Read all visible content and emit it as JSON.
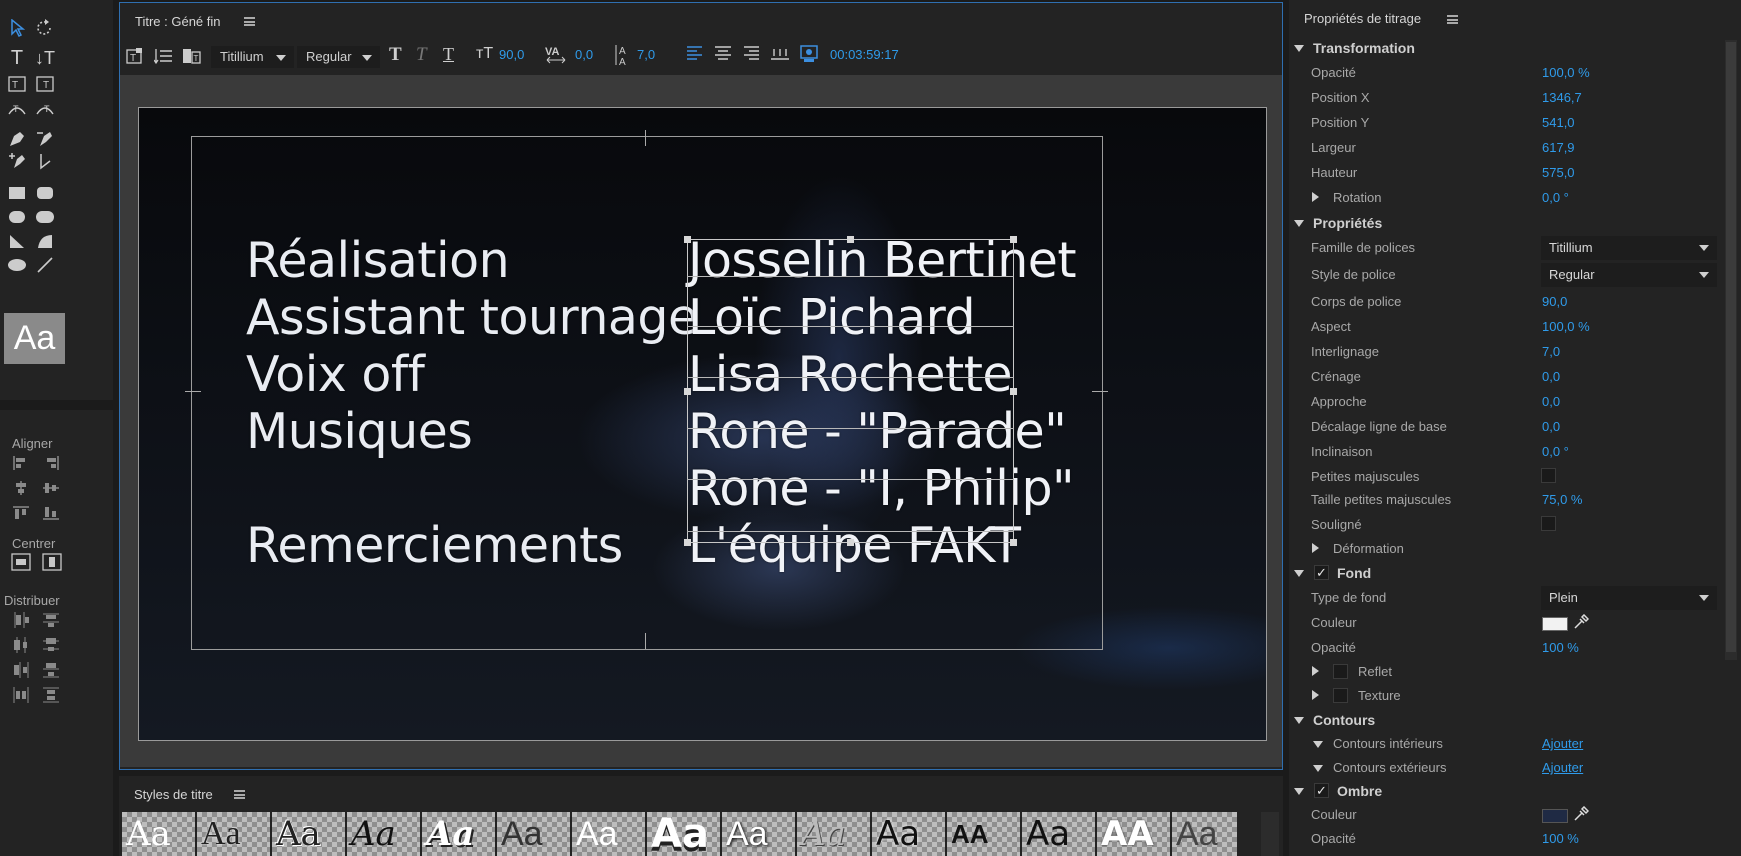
{
  "title_window": {
    "title": "Titre : Géné fin",
    "toolbar": {
      "font_family": "Titillium",
      "font_style": "Regular",
      "font_size": "90,0",
      "kerning": "0,0",
      "leading": "7,0",
      "timecode": "00:03:59:17"
    }
  },
  "credits": {
    "roles": [
      "Réalisation",
      "Assistant tournage",
      "Voix off",
      "Musiques",
      "",
      "Remerciements"
    ],
    "names": [
      "Josselin Bertinet",
      "Loïc Pichard",
      "Lisa Rochette",
      "Rone - \"Parade\"",
      "Rone - \"I, Philip\"",
      "L'équipe FAKT"
    ]
  },
  "left_panel": {
    "aa_swatch": "Aa",
    "align_label": "Aligner",
    "center_label": "Centrer",
    "distribute_label": "Distribuer"
  },
  "styles_panel": {
    "title": "Styles de titre",
    "swatches": [
      "Aa",
      "Aa",
      "Aa",
      "Aa",
      "Aa",
      "Aa",
      "Aa",
      "Aa",
      "Aa",
      "Aa",
      "Aa",
      "AA",
      "Aa",
      "AA",
      "Aa"
    ]
  },
  "properties": {
    "title": "Propriétés de titrage",
    "transformation": {
      "label": "Transformation",
      "opacity_label": "Opacité",
      "opacity": "100,0 %",
      "posx_label": "Position X",
      "posx": "1346,7",
      "posy_label": "Position Y",
      "posy": "541,0",
      "width_label": "Largeur",
      "width": "617,9",
      "height_label": "Hauteur",
      "height": "575,0",
      "rotation_label": "Rotation",
      "rotation": "0,0 °"
    },
    "proprietes": {
      "label": "Propriétés",
      "family_label": "Famille de polices",
      "family": "Titillium",
      "style_label": "Style de police",
      "style": "Regular",
      "size_label": "Corps de police",
      "size": "90,0",
      "aspect_label": "Aspect",
      "aspect": "100,0 %",
      "leading_label": "Interlignage",
      "leading": "7,0",
      "kerning_label": "Crénage",
      "kerning": "0,0",
      "tracking_label": "Approche",
      "tracking": "0,0",
      "baseline_label": "Décalage ligne de base",
      "baseline": "0,0",
      "slant_label": "Inclinaison",
      "slant": "0,0 °",
      "smallcaps_label": "Petites majuscules",
      "smallcaps_size_label": "Taille petites majuscules",
      "smallcaps_size": "75,0 %",
      "underline_label": "Souligné",
      "distort_label": "Déformation"
    },
    "fond": {
      "label": "Fond",
      "type_label": "Type de fond",
      "type": "Plein",
      "color_label": "Couleur",
      "color": "#f2f2f2",
      "opacity_label": "Opacité",
      "opacity": "100 %",
      "sheen_label": "Reflet",
      "texture_label": "Texture"
    },
    "contours": {
      "label": "Contours",
      "inner_label": "Contours intérieurs",
      "inner_action": "Ajouter",
      "outer_label": "Contours extérieurs",
      "outer_action": "Ajouter"
    },
    "ombre": {
      "label": "Ombre",
      "color_label": "Couleur",
      "color": "#1f2a44",
      "opacity_label": "Opacité",
      "opacity": "100 %"
    }
  }
}
